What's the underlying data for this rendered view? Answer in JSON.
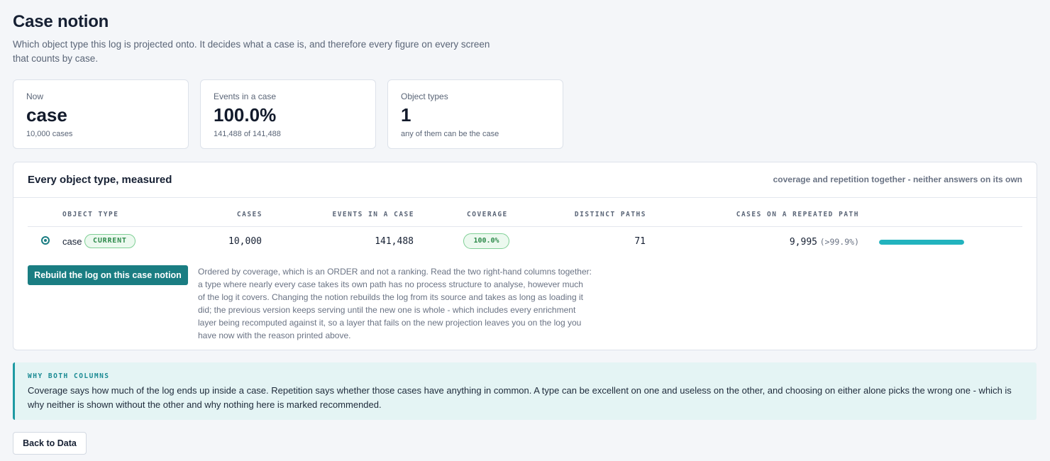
{
  "page": {
    "title": "Case notion",
    "description": "Which object type this log is projected onto. It decides what a case is, and therefore every figure on every screen that counts by case."
  },
  "stats": [
    {
      "label": "Now",
      "value": "case",
      "sub": "10,000 cases"
    },
    {
      "label": "Events in a case",
      "value": "100.0%",
      "sub": "141,488 of 141,488"
    },
    {
      "label": "Object types",
      "value": "1",
      "sub": "any of them can be the case"
    }
  ],
  "panel": {
    "title": "Every object type, measured",
    "note": "coverage and repetition together - neither answers on its own"
  },
  "table": {
    "headers": [
      "OBJECT TYPE",
      "CASES",
      "EVENTS IN A CASE",
      "COVERAGE",
      "DISTINCT PATHS",
      "CASES ON A REPEATED PATH"
    ],
    "rows": [
      {
        "object_type": "case",
        "badge": "CURRENT",
        "cases": "10,000",
        "events": "141,488",
        "coverage": "100.0%",
        "distinct_paths": "71",
        "repeated": "9,995",
        "repeated_pct": "(>99.9%)",
        "repeated_fraction": 0.9995,
        "selected": true
      }
    ]
  },
  "rebuild": {
    "button_label": "Rebuild the log on this case notion",
    "note": "Ordered by coverage, which is an ORDER and not a ranking. Read the two right-hand columns together: a type where nearly every case takes its own path has no process structure to analyse, however much of the log it covers. Changing the notion rebuilds the log from its source and takes as long as loading it did; the previous version keeps serving until the new one is whole - which includes every enrichment layer being recomputed against it, so a layer that fails on the new projection leaves you on the log you have now with the reason printed above."
  },
  "why": {
    "heading": "WHY BOTH COLUMNS",
    "text": "Coverage says how much of the log ends up inside a case. Repetition says whether those cases have anything in common. A type can be excellent on one and useless on the other, and choosing on either alone picks the wrong one - which is why neither is shown without the other and why nothing here is marked recommended."
  },
  "footer": {
    "back_label": "Back to Data"
  },
  "colors": {
    "accent": "#1a7d82",
    "bar": "#22b3be",
    "badge_green": "#2e8a4b",
    "why_bg": "#e4f4f4"
  }
}
